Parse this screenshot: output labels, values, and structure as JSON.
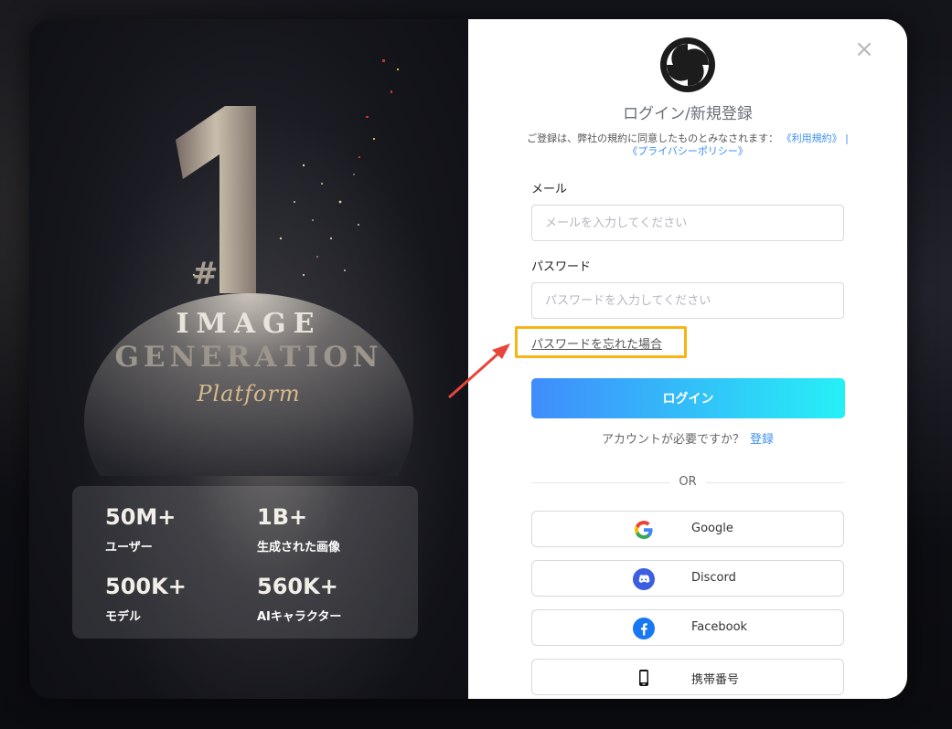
{
  "hero": {
    "number": "1",
    "hash": "#",
    "line1": "IMAGE",
    "line2": "GENERATION",
    "line3": "Platform"
  },
  "stats": [
    {
      "value": "50M+",
      "label": "ユーザー"
    },
    {
      "value": "1B+",
      "label": "生成された画像"
    },
    {
      "value": "500K+",
      "label": "モデル"
    },
    {
      "value": "560K+",
      "label": "AIキャラクター"
    }
  ],
  "login": {
    "close_symbol": "×",
    "title": "ログイン/新規登録",
    "terms_text": "ご登録は、弊社の規約に同意したものとみなされます：",
    "terms_link": "《利用規約》",
    "terms_sep": "|",
    "privacy_link": "《プライバシーポリシー》",
    "email_label": "メール",
    "email_placeholder": "メールを入力してください",
    "password_label": "パスワード",
    "password_placeholder": "パスワードを入力してください",
    "forgot_label": "パスワードを忘れた場合",
    "login_button": "ログイン",
    "need_account": "アカウントが必要ですか？",
    "signup_link": "登録",
    "or_text": "OR",
    "social": [
      {
        "label": "Google",
        "icon": "google-icon"
      },
      {
        "label": "Discord",
        "icon": "discord-icon"
      },
      {
        "label": "Facebook",
        "icon": "facebook-icon"
      },
      {
        "label": "携帯番号",
        "icon": "mobile-phone-icon"
      }
    ]
  },
  "colors": {
    "highlight": "#f7b515",
    "annotation_arrow": "#e8453c",
    "link": "#3d8ff0",
    "button_start": "#3f8cfb",
    "button_end": "#26f0f6"
  }
}
